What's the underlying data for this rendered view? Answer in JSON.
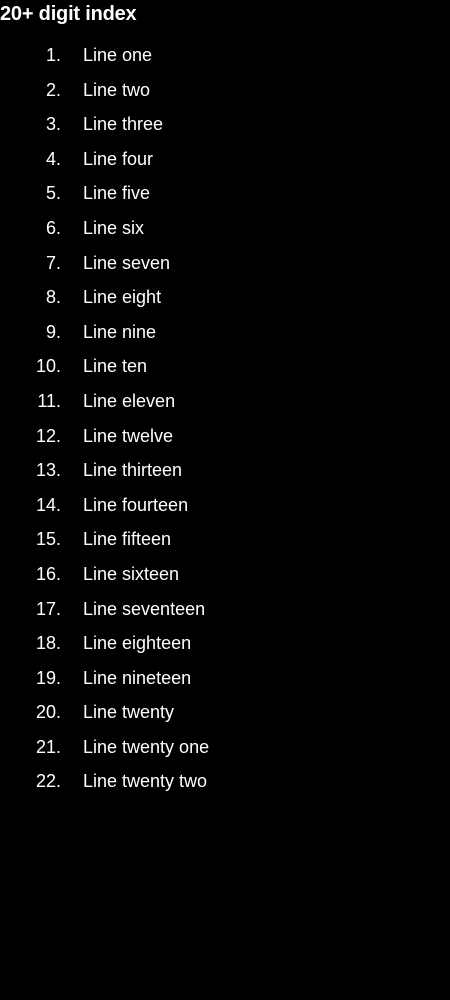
{
  "page": {
    "title": "20+ digit index",
    "background": "#000000",
    "text_color": "#ffffff"
  },
  "list": {
    "items": [
      {
        "number": "1.",
        "label": "Line one"
      },
      {
        "number": "2.",
        "label": "Line two"
      },
      {
        "number": "3.",
        "label": "Line three"
      },
      {
        "number": "4.",
        "label": "Line four"
      },
      {
        "number": "5.",
        "label": "Line five"
      },
      {
        "number": "6.",
        "label": "Line six"
      },
      {
        "number": "7.",
        "label": "Line seven"
      },
      {
        "number": "8.",
        "label": "Line eight"
      },
      {
        "number": "9.",
        "label": "Line nine"
      },
      {
        "number": "10.",
        "label": "Line ten"
      },
      {
        "number": "11.",
        "label": "Line eleven"
      },
      {
        "number": "12.",
        "label": "Line twelve"
      },
      {
        "number": "13.",
        "label": "Line thirteen"
      },
      {
        "number": "14.",
        "label": "Line fourteen"
      },
      {
        "number": "15.",
        "label": "Line fifteen"
      },
      {
        "number": "16.",
        "label": "Line sixteen"
      },
      {
        "number": "17.",
        "label": "Line seventeen"
      },
      {
        "number": "18.",
        "label": "Line eighteen"
      },
      {
        "number": "19.",
        "label": "Line nineteen"
      },
      {
        "number": "20.",
        "label": "Line twenty"
      },
      {
        "number": "21.",
        "label": "Line twenty one"
      },
      {
        "number": "22.",
        "label": "Line twenty two"
      }
    ]
  }
}
